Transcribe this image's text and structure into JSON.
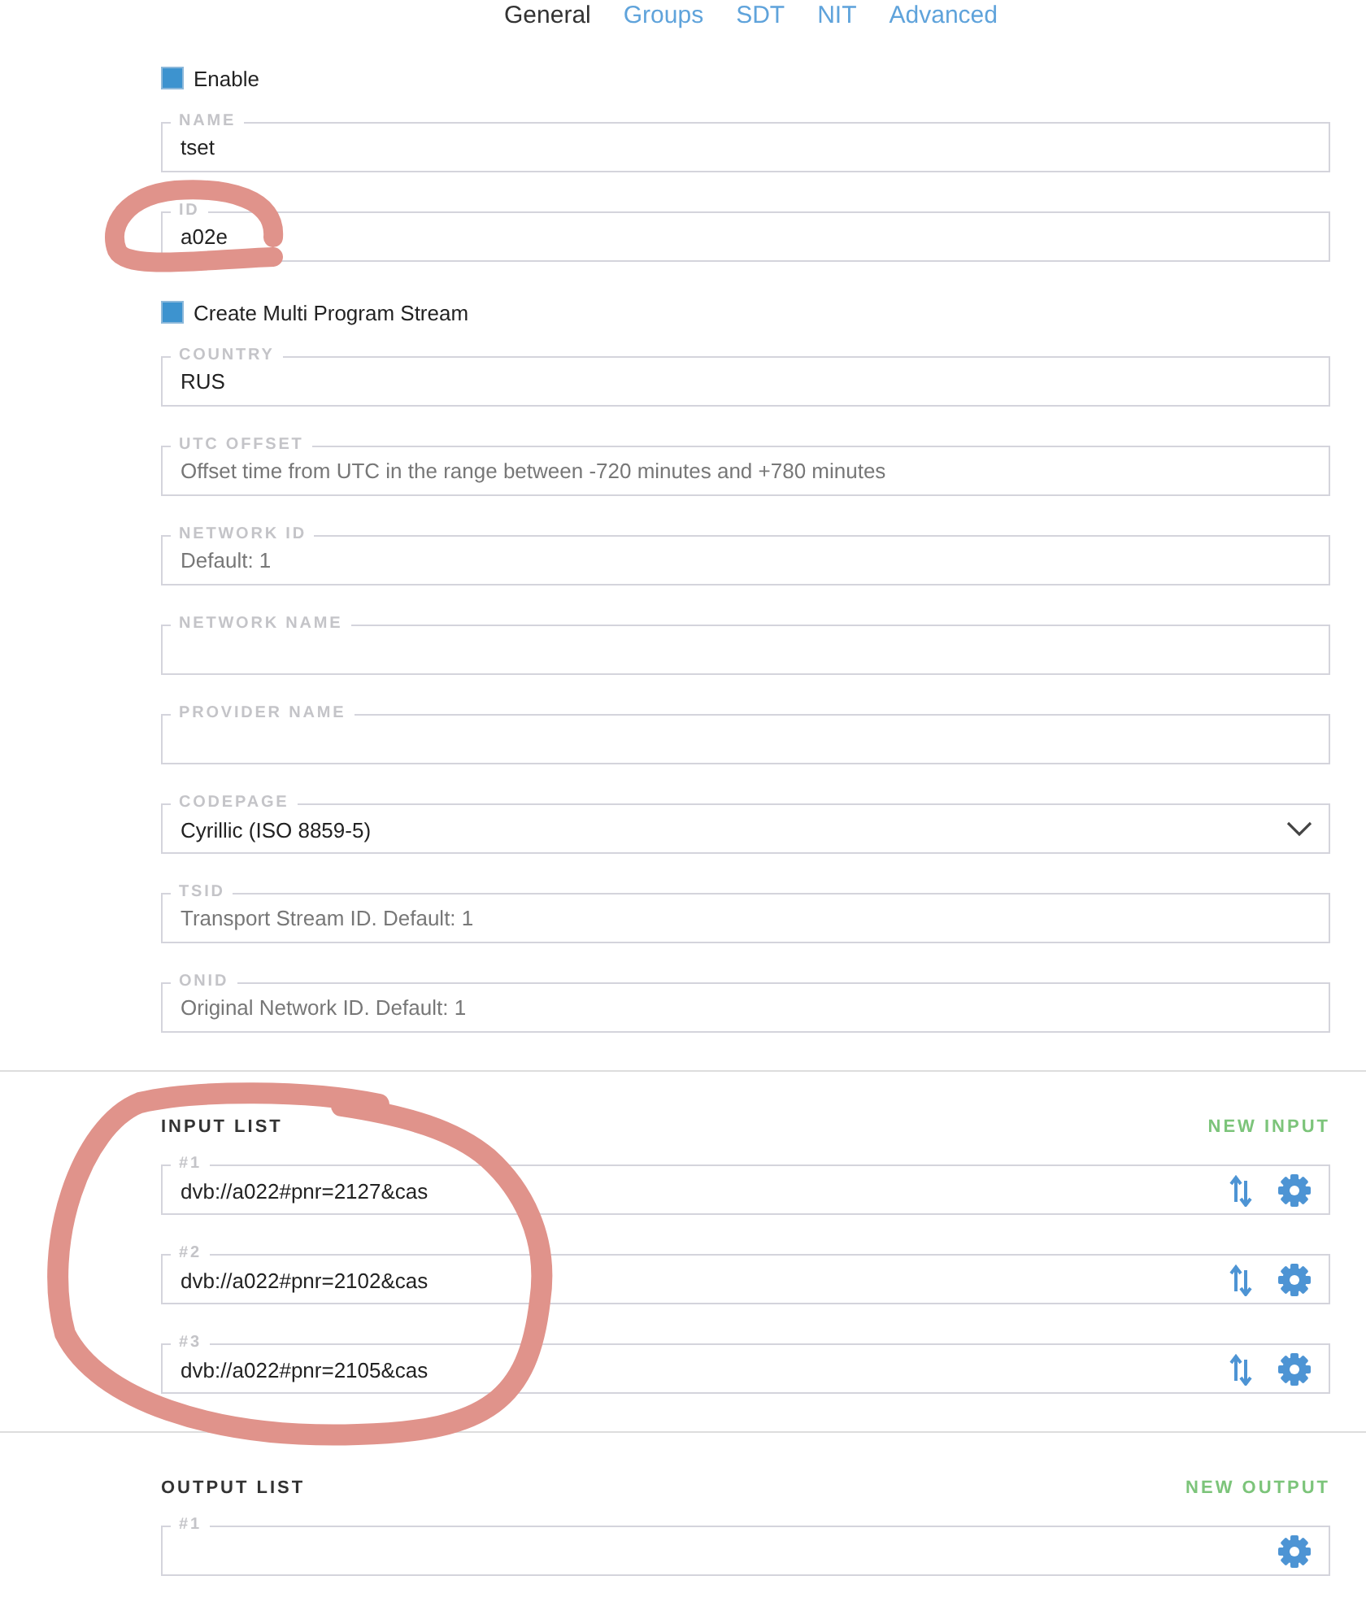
{
  "tabs": [
    {
      "label": "General",
      "selected": true
    },
    {
      "label": "Groups",
      "selected": false
    },
    {
      "label": "SDT",
      "selected": false
    },
    {
      "label": "NIT",
      "selected": false
    },
    {
      "label": "Advanced",
      "selected": false
    }
  ],
  "general": [
    {
      "kind": "checkbox",
      "label": "Enable",
      "checked": true
    },
    {
      "kind": "field",
      "label": "NAME",
      "value": "tset"
    },
    {
      "kind": "field",
      "label": "ID",
      "value": "a02e"
    },
    {
      "kind": "checkbox",
      "label": "Create Multi Program Stream",
      "checked": true
    },
    {
      "kind": "field",
      "label": "COUNTRY",
      "value": "RUS"
    },
    {
      "kind": "field",
      "label": "UTC OFFSET",
      "placeholder": "Offset time from UTC in the range between -720 minutes and +780 minutes"
    },
    {
      "kind": "field",
      "label": "NETWORK ID",
      "placeholder": "Default: 1"
    },
    {
      "kind": "field",
      "label": "NETWORK NAME"
    },
    {
      "kind": "field",
      "label": "PROVIDER NAME"
    },
    {
      "kind": "select",
      "label": "CODEPAGE",
      "value": "Cyrillic (ISO 8859-5)"
    },
    {
      "kind": "field",
      "label": "TSID",
      "placeholder": "Transport Stream ID. Default: 1"
    },
    {
      "kind": "field",
      "label": "ONID",
      "placeholder": "Original Network ID. Default: 1"
    }
  ],
  "input_list": {
    "title": "INPUT LIST",
    "action": "NEW INPUT",
    "items": [
      {
        "label": "#1",
        "value": "dvb://a022#pnr=2127&cas"
      },
      {
        "label": "#2",
        "value": "dvb://a022#pnr=2102&cas"
      },
      {
        "label": "#3",
        "value": "dvb://a022#pnr=2105&cas"
      }
    ]
  },
  "output_list": {
    "title": "OUTPUT LIST",
    "action": "NEW OUTPUT",
    "items": [
      {
        "label": "#1"
      }
    ]
  }
}
